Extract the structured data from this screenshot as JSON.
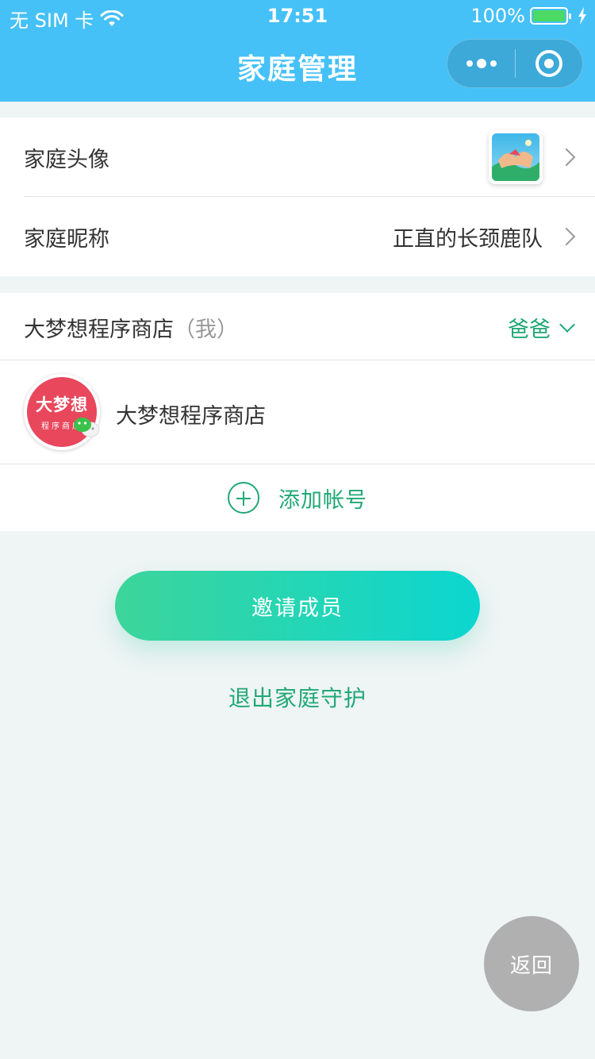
{
  "status_bar": {
    "carrier": "无 SIM 卡",
    "time": "17:51",
    "battery": "100%"
  },
  "nav": {
    "title": "家庭管理"
  },
  "family": {
    "avatar_label": "家庭头像",
    "nickname_label": "家庭昵称",
    "nickname_value": "正直的长颈鹿队"
  },
  "member": {
    "name": "大梦想程序商店",
    "me_tag": "（我）",
    "role": "爸爸",
    "account_name": "大梦想程序商店",
    "avatar_text_big": "大梦想",
    "avatar_text_small": "程序商店",
    "add_account_label": "添加帐号"
  },
  "actions": {
    "invite_label": "邀请成员",
    "quit_label": "退出家庭守护",
    "back_label": "返回"
  },
  "colors": {
    "nav_bg": "#45c1f7",
    "accent_green": "#20a876",
    "avatar_red": "#e8475c"
  }
}
